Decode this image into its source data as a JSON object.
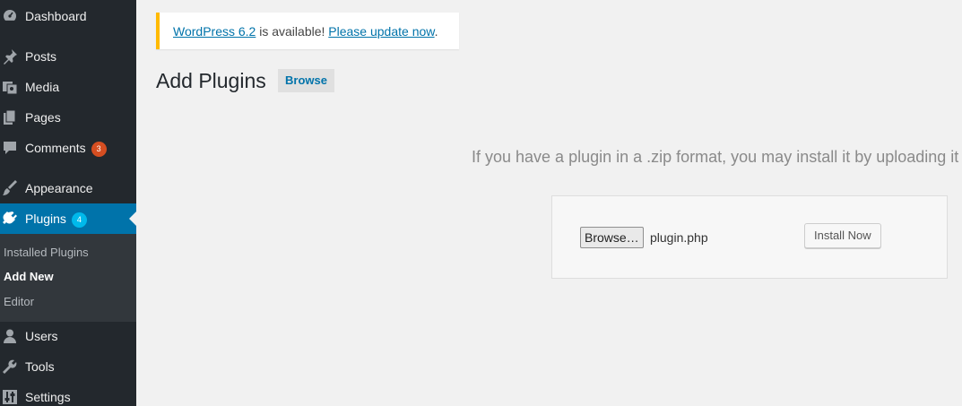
{
  "sidebar": {
    "items": {
      "dashboard": {
        "label": "Dashboard",
        "icon": "dashboard-icon"
      },
      "posts": {
        "label": "Posts",
        "icon": "pushpin-icon"
      },
      "media": {
        "label": "Media",
        "icon": "media-icon"
      },
      "pages": {
        "label": "Pages",
        "icon": "pages-icon"
      },
      "comments": {
        "label": "Comments",
        "icon": "comment-icon",
        "badge": "3"
      },
      "appearance": {
        "label": "Appearance",
        "icon": "paintbrush-icon"
      },
      "plugins": {
        "label": "Plugins",
        "icon": "plug-icon",
        "badge": "4"
      },
      "users": {
        "label": "Users",
        "icon": "user-icon"
      },
      "tools": {
        "label": "Tools",
        "icon": "wrench-icon"
      },
      "settings": {
        "label": "Settings",
        "icon": "settings-sliders-icon"
      }
    },
    "submenu": {
      "installed": "Installed Plugins",
      "add_new": "Add New",
      "editor": "Editor"
    }
  },
  "notice": {
    "link_version": "WordPress 6.2",
    "text_middle": " is available! ",
    "link_update": "Please update now",
    "text_end": "."
  },
  "main": {
    "title": "Add Plugins",
    "browse_button": "Browse",
    "upload_description": "If you have a plugin in a .zip format, you may install it by uploading it here.",
    "file_button": "Browse…",
    "file_name": "plugin.php",
    "install_button": "Install Now"
  },
  "colors": {
    "sidebar_bg": "#23282d",
    "submenu_bg": "#32373c",
    "accent": "#0073aa",
    "notice_border": "#ffba00",
    "badge_red": "#d54e21",
    "badge_blue": "#00b9eb"
  }
}
